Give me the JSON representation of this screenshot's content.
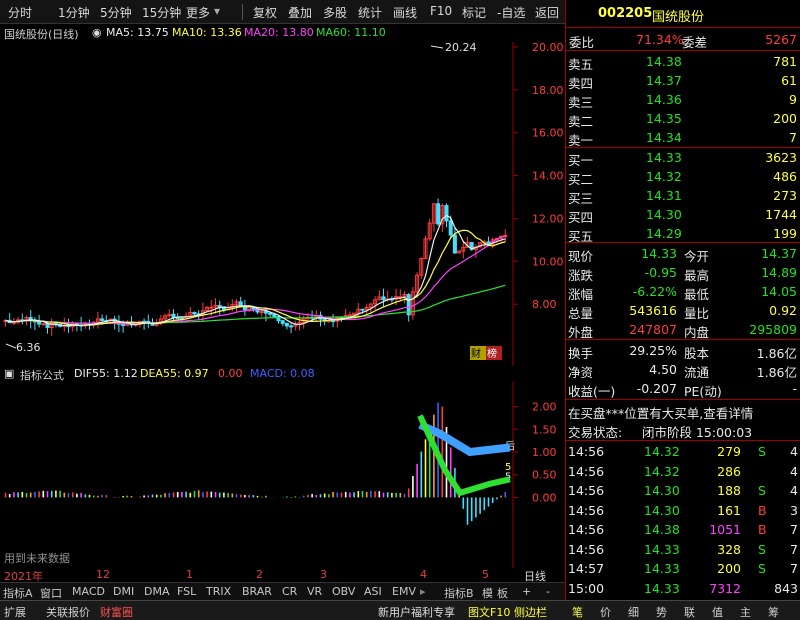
{
  "toolbar": {
    "left_tabs": [
      "分时",
      "1分钟",
      "5分钟",
      "15分钟",
      "更多"
    ],
    "buttons": [
      "复权",
      "叠加",
      "多股",
      "统计",
      "画线",
      "F10",
      "标记",
      "-自选",
      "返回"
    ]
  },
  "header": {
    "stock_name": "国统股份(日线)",
    "ma5": "MA5: 13.75",
    "ma10": "MA10: 13.36",
    "ma20": "MA20: 13.80",
    "ma60": "MA60: 11.10"
  },
  "price_axis": [
    "20.00",
    "18.00",
    "16.00",
    "14.00",
    "12.00",
    "10.00",
    "8.00"
  ],
  "price_marks": {
    "high": "20.24",
    "low": "6.36"
  },
  "price_badge": "财",
  "price_badge2": "榜",
  "indicator_bar": {
    "name": "指标公式",
    "dif": "DIF55: 1.12",
    "dea": "DEA55: 0.97",
    "val": "0.00",
    "macd": "MACD: 0.08"
  },
  "macd_axis": [
    "2.00",
    "1.50",
    "1.00",
    "0.50",
    "0.00"
  ],
  "macd_marks": {
    "a": "后",
    "b": "5",
    "c": "5"
  },
  "macd_note": "用到未来数据",
  "xaxis": {
    "year": "2021年",
    "ticks": [
      "12",
      "1",
      "2",
      "3",
      "4",
      "5"
    ],
    "right": "日线"
  },
  "tabs": [
    "指标A",
    "窗口",
    "MACD",
    "DMI",
    "DMA",
    "FSL",
    "TRIX",
    "BRAR",
    "CR",
    "VR",
    "OBV",
    "ASI",
    "EMV",
    "指标B",
    "模",
    "板",
    "+",
    "-"
  ],
  "bottom": {
    "left": [
      "扩展",
      "关联报价",
      "财富圈"
    ],
    "mid": [
      "新用户福利专享",
      "图文F10",
      "侧边栏"
    ],
    "right": [
      "笔",
      "价",
      "细",
      "势",
      "联",
      "值",
      "主",
      "筹"
    ]
  },
  "quote": {
    "code": "002205",
    "name": "国统股份",
    "weibi_label": "委比",
    "weibi": "71.34%",
    "weicha_label": "委差",
    "weicha": "5267",
    "sells": [
      {
        "label": "卖五",
        "price": "14.38",
        "vol": "781"
      },
      {
        "label": "卖四",
        "price": "14.37",
        "vol": "61"
      },
      {
        "label": "卖三",
        "price": "14.36",
        "vol": "9"
      },
      {
        "label": "卖二",
        "price": "14.35",
        "vol": "200"
      },
      {
        "label": "卖一",
        "price": "14.34",
        "vol": "7"
      }
    ],
    "buys": [
      {
        "label": "买一",
        "price": "14.33",
        "vol": "3623"
      },
      {
        "label": "买二",
        "price": "14.32",
        "vol": "486"
      },
      {
        "label": "买三",
        "price": "14.31",
        "vol": "273"
      },
      {
        "label": "买四",
        "price": "14.30",
        "vol": "1744"
      },
      {
        "label": "买五",
        "price": "14.29",
        "vol": "199"
      }
    ],
    "stats": [
      {
        "l1": "现价",
        "v1": "14.33",
        "l2": "今开",
        "v2": "14.37"
      },
      {
        "l1": "涨跌",
        "v1": "-0.95",
        "l2": "最高",
        "v2": "14.89"
      },
      {
        "l1": "涨幅",
        "v1": "-6.22%",
        "l2": "最低",
        "v2": "14.05"
      },
      {
        "l1": "总量",
        "v1": "543616",
        "l2": "量比",
        "v2": "0.92"
      },
      {
        "l1": "外盘",
        "v1": "247807",
        "l2": "内盘",
        "v2": "295809"
      }
    ],
    "stats2": [
      {
        "l1": "换手",
        "v1": "29.25%",
        "l2": "股本",
        "v2": "1.86亿"
      },
      {
        "l1": "净资",
        "v1": "4.50",
        "l2": "流通",
        "v2": "1.86亿"
      },
      {
        "l1": "收益(一)",
        "v1": "-0.207",
        "l2": "PE(动)",
        "v2": "-"
      }
    ],
    "notice": "在买盘***位置有大买单,查看详情",
    "status_label": "交易状态:",
    "status": "闭市阶段 15:00:03",
    "ticks": [
      {
        "t": "14:56",
        "p": "14.32",
        "v": "279",
        "d": "S",
        "n": "4"
      },
      {
        "t": "14:56",
        "p": "14.32",
        "v": "286",
        "d": "",
        "n": "4"
      },
      {
        "t": "14:56",
        "p": "14.30",
        "v": "188",
        "d": "S",
        "n": "4"
      },
      {
        "t": "14:56",
        "p": "14.30",
        "v": "161",
        "d": "B",
        "n": "3"
      },
      {
        "t": "14:56",
        "p": "14.38",
        "v": "1051",
        "d": "B",
        "n": "7"
      },
      {
        "t": "14:56",
        "p": "14.33",
        "v": "328",
        "d": "S",
        "n": "7"
      },
      {
        "t": "14:57",
        "p": "14.33",
        "v": "200",
        "d": "S",
        "n": "7"
      },
      {
        "t": "15:00",
        "p": "14.33",
        "v": "7312",
        "d": "",
        "n": "843"
      }
    ]
  }
}
